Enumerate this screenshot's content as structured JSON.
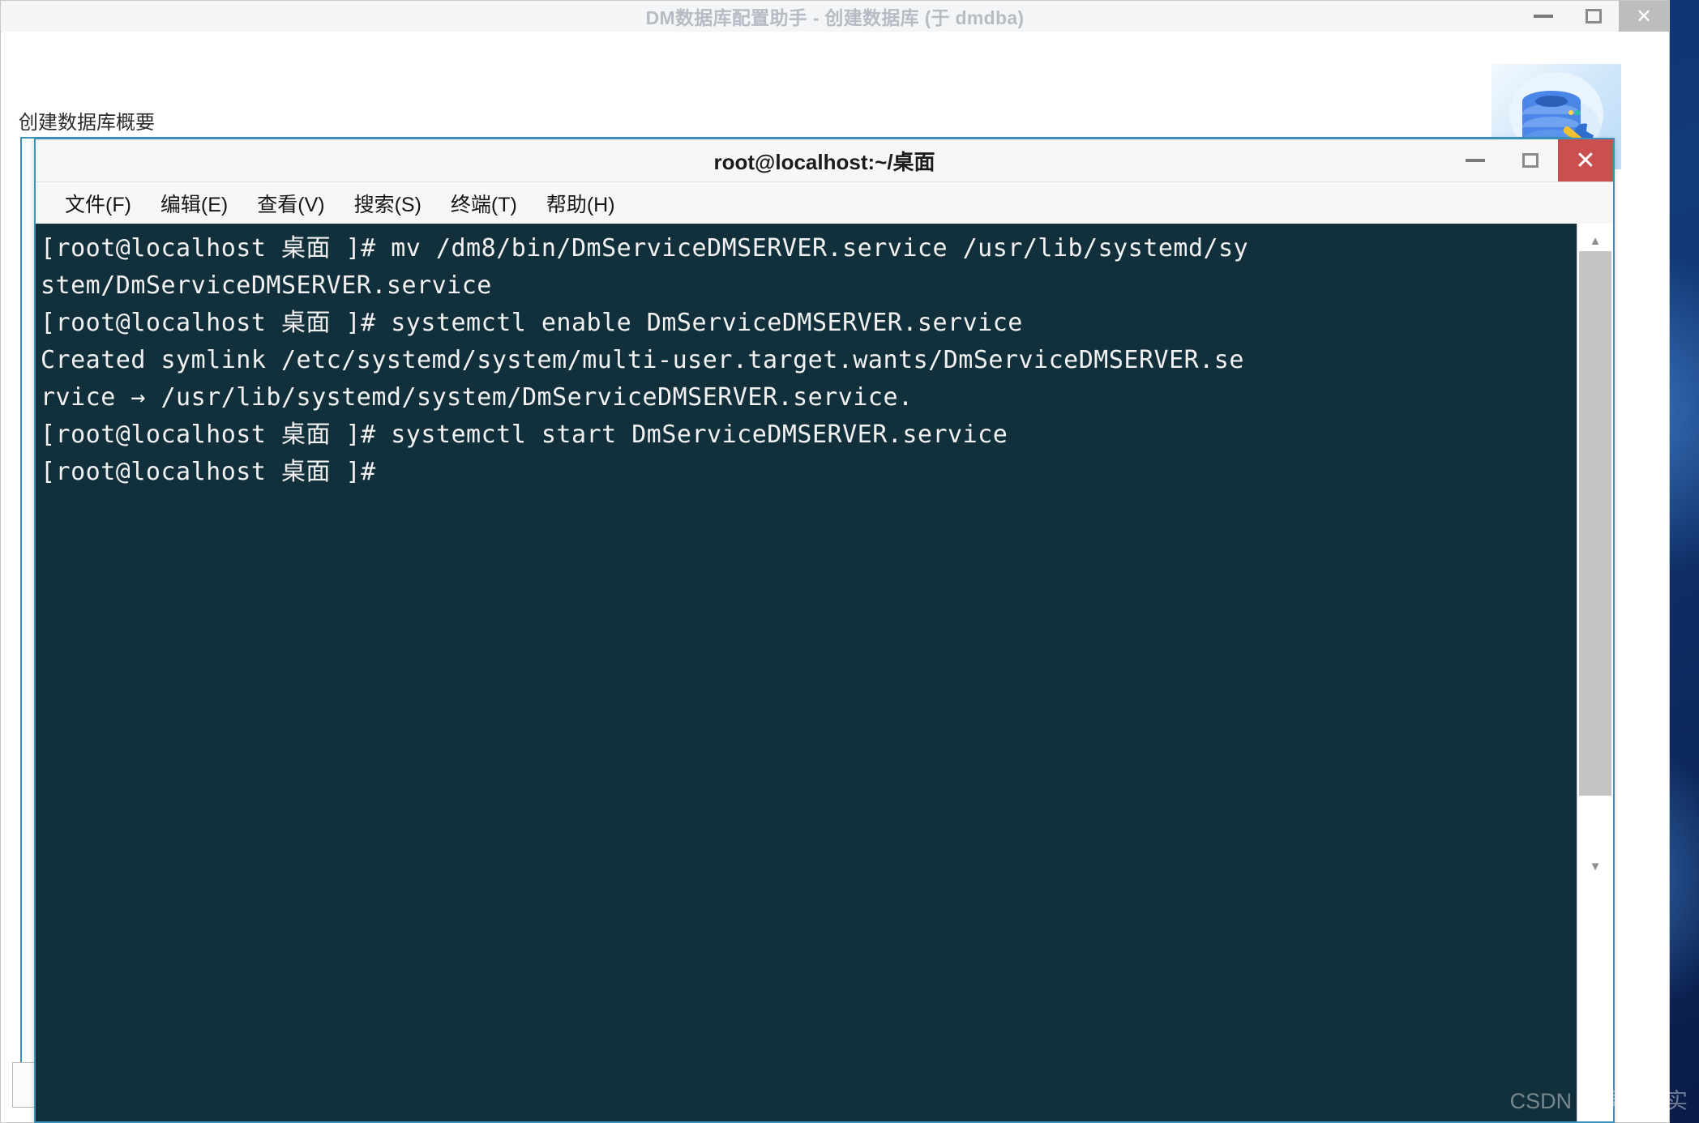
{
  "dm_window": {
    "title": "DM数据库配置助手 - 创建数据库 (于 dmdba)",
    "section_label": "创建数据库概要",
    "window_buttons": {
      "minimize": "—",
      "maximize": "❐",
      "close": "✕"
    },
    "logo_icon": "database-wrench-icon",
    "scrollbar": {
      "up_arrow": "▲",
      "down_arrow": "▼"
    },
    "step_markers": [
      "✔",
      "✔",
      "✔",
      "✔",
      "✔",
      "✔",
      "✔",
      "✔",
      "—"
    ]
  },
  "terminal_window": {
    "title": "root@localhost:~/桌面",
    "window_buttons": {
      "minimize": "—",
      "maximize": "❐",
      "close": "✕"
    },
    "menu": [
      {
        "label": "文件(F)",
        "name": "menu-file"
      },
      {
        "label": "编辑(E)",
        "name": "menu-edit"
      },
      {
        "label": "查看(V)",
        "name": "menu-view"
      },
      {
        "label": "搜索(S)",
        "name": "menu-search"
      },
      {
        "label": "终端(T)",
        "name": "menu-terminal"
      },
      {
        "label": "帮助(H)",
        "name": "menu-help"
      }
    ],
    "prompt": "[root@localhost 桌面 ]#",
    "lines": [
      "[root@localhost 桌面 ]# mv /dm8/bin/DmServiceDMSERVER.service /usr/lib/systemd/sy",
      "stem/DmServiceDMSERVER.service",
      "[root@localhost 桌面 ]# systemctl enable DmServiceDMSERVER.service",
      "Created symlink /etc/systemd/system/multi-user.target.wants/DmServiceDMSERVER.se",
      "rvice → /usr/lib/systemd/system/DmServiceDMSERVER.service.",
      "[root@localhost 桌面 ]# systemctl start DmServiceDMSERVER.service",
      "[root@localhost 桌面 ]#"
    ],
    "scrollbar": {
      "up_arrow": "▲",
      "down_arrow": "▼"
    },
    "colors": {
      "background": "#12303b",
      "foreground": "#f2f2f2",
      "border": "#3b92bd",
      "close_button": "#c9504f"
    }
  },
  "watermark": {
    "text": "CSDN @果子果实"
  }
}
